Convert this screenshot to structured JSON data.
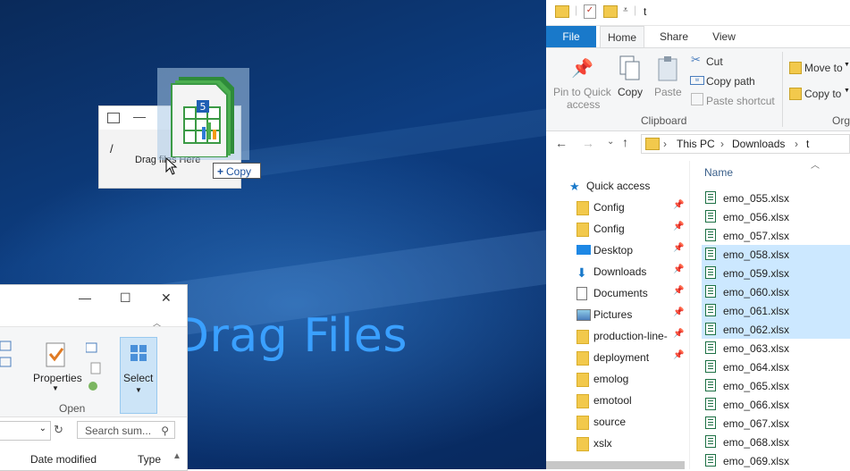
{
  "desktop": {
    "drag_overlay_text": "Drag Files"
  },
  "mini_window": {
    "path_text": "/",
    "hint_text": "Drag files Here",
    "drag_tooltip": "Copy",
    "drag_tooltip_symbol": "+"
  },
  "left_window": {
    "ribbon": {
      "properties_label": "Properties",
      "select_label": "Select",
      "open_group_label": "Open"
    },
    "search_placeholder": "Search sum...",
    "columns": [
      "Date modified",
      "Type"
    ]
  },
  "explorer": {
    "title": "t",
    "tabs": [
      "File",
      "Home",
      "Share",
      "View"
    ],
    "ribbon": {
      "pin_label_1": "Pin to Quick",
      "pin_label_2": "access",
      "copy_label": "Copy",
      "paste_label": "Paste",
      "cut_label": "Cut",
      "copy_path_label": "Copy path",
      "paste_shortcut_label": "Paste shortcut",
      "clipboard_group": "Clipboard",
      "move_to_label": "Move to",
      "copy_to_label": "Copy to",
      "org_group": "Org"
    },
    "breadcrumb": [
      "This PC",
      "Downloads",
      "t"
    ],
    "column_name": "Name",
    "nav": [
      {
        "label": "Quick access",
        "icon": "star-icon",
        "pinned": false
      },
      {
        "label": "Config",
        "icon": "folder-icon",
        "pinned": true
      },
      {
        "label": "Config",
        "icon": "folder-icon",
        "pinned": true
      },
      {
        "label": "Desktop",
        "icon": "desktop-icon",
        "pinned": true
      },
      {
        "label": "Downloads",
        "icon": "download-icon",
        "pinned": true
      },
      {
        "label": "Documents",
        "icon": "documents-icon",
        "pinned": true
      },
      {
        "label": "Pictures",
        "icon": "pictures-icon",
        "pinned": true
      },
      {
        "label": "production-line-",
        "icon": "folder-icon",
        "pinned": true
      },
      {
        "label": "deployment",
        "icon": "folder-icon",
        "pinned": true
      },
      {
        "label": "emolog",
        "icon": "folder-icon",
        "pinned": false
      },
      {
        "label": "emotool",
        "icon": "folder-icon",
        "pinned": false
      },
      {
        "label": "source",
        "icon": "folder-icon",
        "pinned": false
      },
      {
        "label": "xslx",
        "icon": "folder-icon",
        "pinned": false
      }
    ],
    "files": [
      {
        "name": "emo_055.xlsx",
        "selected": false
      },
      {
        "name": "emo_056.xlsx",
        "selected": false
      },
      {
        "name": "emo_057.xlsx",
        "selected": false
      },
      {
        "name": "emo_058.xlsx",
        "selected": true
      },
      {
        "name": "emo_059.xlsx",
        "selected": true
      },
      {
        "name": "emo_060.xlsx",
        "selected": true
      },
      {
        "name": "emo_061.xlsx",
        "selected": true
      },
      {
        "name": "emo_062.xlsx",
        "selected": true
      },
      {
        "name": "emo_063.xlsx",
        "selected": false
      },
      {
        "name": "emo_064.xlsx",
        "selected": false
      },
      {
        "name": "emo_065.xlsx",
        "selected": false
      },
      {
        "name": "emo_066.xlsx",
        "selected": false
      },
      {
        "name": "emo_067.xlsx",
        "selected": false
      },
      {
        "name": "emo_068.xlsx",
        "selected": false
      },
      {
        "name": "emo_069.xlsx",
        "selected": false
      }
    ],
    "colors": {
      "file_tab": "#1979ca",
      "selection": "#cce8ff",
      "excel_green": "#1e7145"
    }
  }
}
